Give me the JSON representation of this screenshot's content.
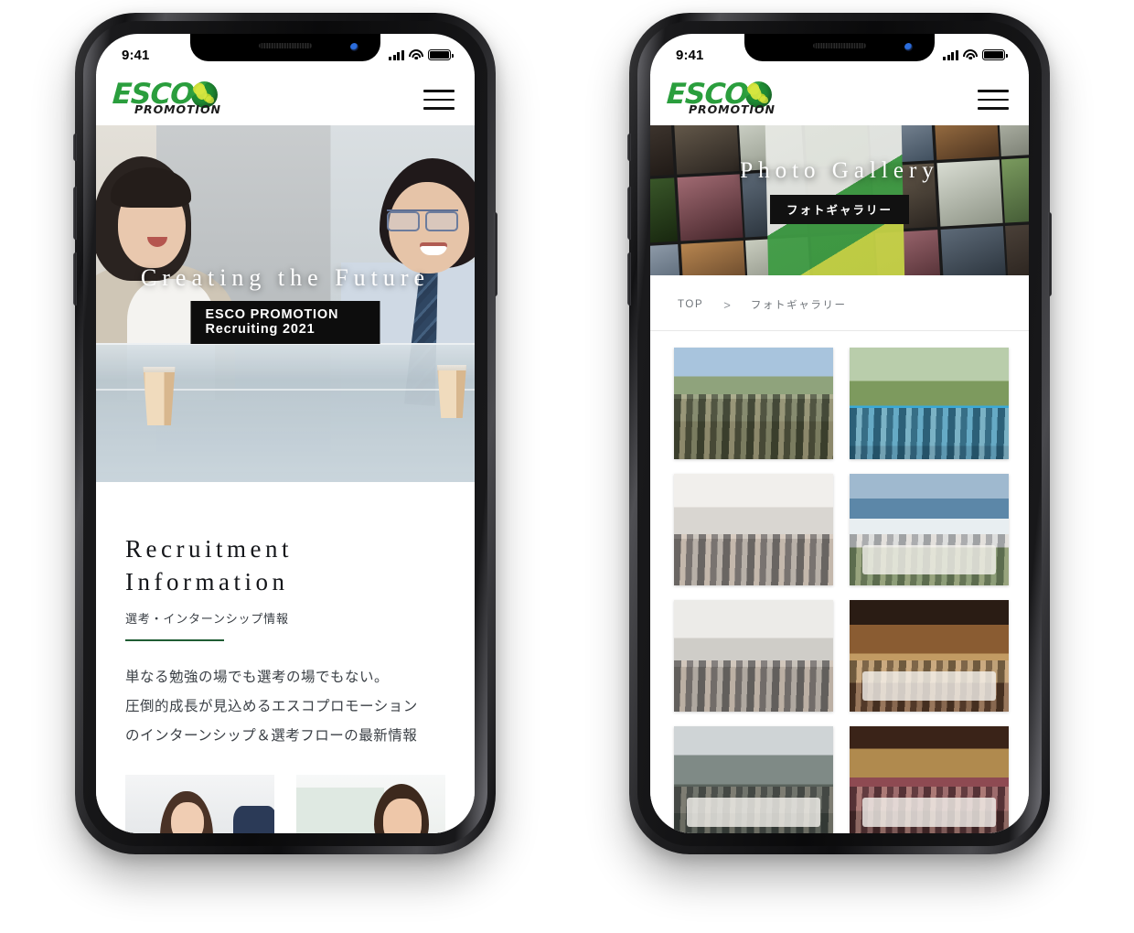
{
  "brand": {
    "name": "ESCO",
    "sub": "PROMOTION",
    "accent_green": "#2a9e3d",
    "rule_green": "#1f5c33"
  },
  "status_bar": {
    "time": "9:41",
    "cellular_icon": "signal-bars-icon",
    "wifi_icon": "wifi-icon",
    "battery_icon": "battery-icon"
  },
  "phone_1": {
    "header": {
      "menu_icon": "hamburger-menu-icon"
    },
    "hero": {
      "title": "Creating the Future",
      "badge": "ESCO PROMOTION Recruiting 2021"
    },
    "section": {
      "title_line_1": "Recruitment",
      "title_line_2": "Information",
      "subtitle": "選考・インターンシップ情報",
      "lead_line_1": "単なる勉強の場でも選考の場でもない。",
      "lead_line_2": "圧倒的成長が見込めるエスコプロモーション",
      "lead_line_3": "のインターンシップ＆選考フローの最新情報"
    },
    "thumbnails": [
      {
        "alt": "interview-photo-woman"
      },
      {
        "alt": "interview-photo-man"
      }
    ]
  },
  "phone_2": {
    "header": {
      "menu_icon": "hamburger-menu-icon"
    },
    "banner": {
      "title": "Photo Gallery",
      "badge": "フォトギャラリー"
    },
    "breadcrumb": {
      "home": "TOP",
      "separator": ">",
      "current": "フォトギャラリー"
    },
    "gallery": [
      {
        "alt": "group-photo-under-cherry-blossoms",
        "style": "ph-park"
      },
      {
        "alt": "hanami-picnic-on-blue-sheet",
        "style": "ph-picnic"
      },
      {
        "alt": "office-group-with-stroller",
        "style": "ph-office"
      },
      {
        "alt": "riverside-party-long-table",
        "style": "ph-river"
      },
      {
        "alt": "office-desk-celebration-with-cake",
        "style": "ph-desk"
      },
      {
        "alt": "izakaya-dinner-group",
        "style": "ph-izakaya"
      },
      {
        "alt": "rooftop-bbq-toast",
        "style": "ph-bbq"
      },
      {
        "alt": "banquet-hall-round-table",
        "style": "ph-banquet"
      }
    ]
  }
}
